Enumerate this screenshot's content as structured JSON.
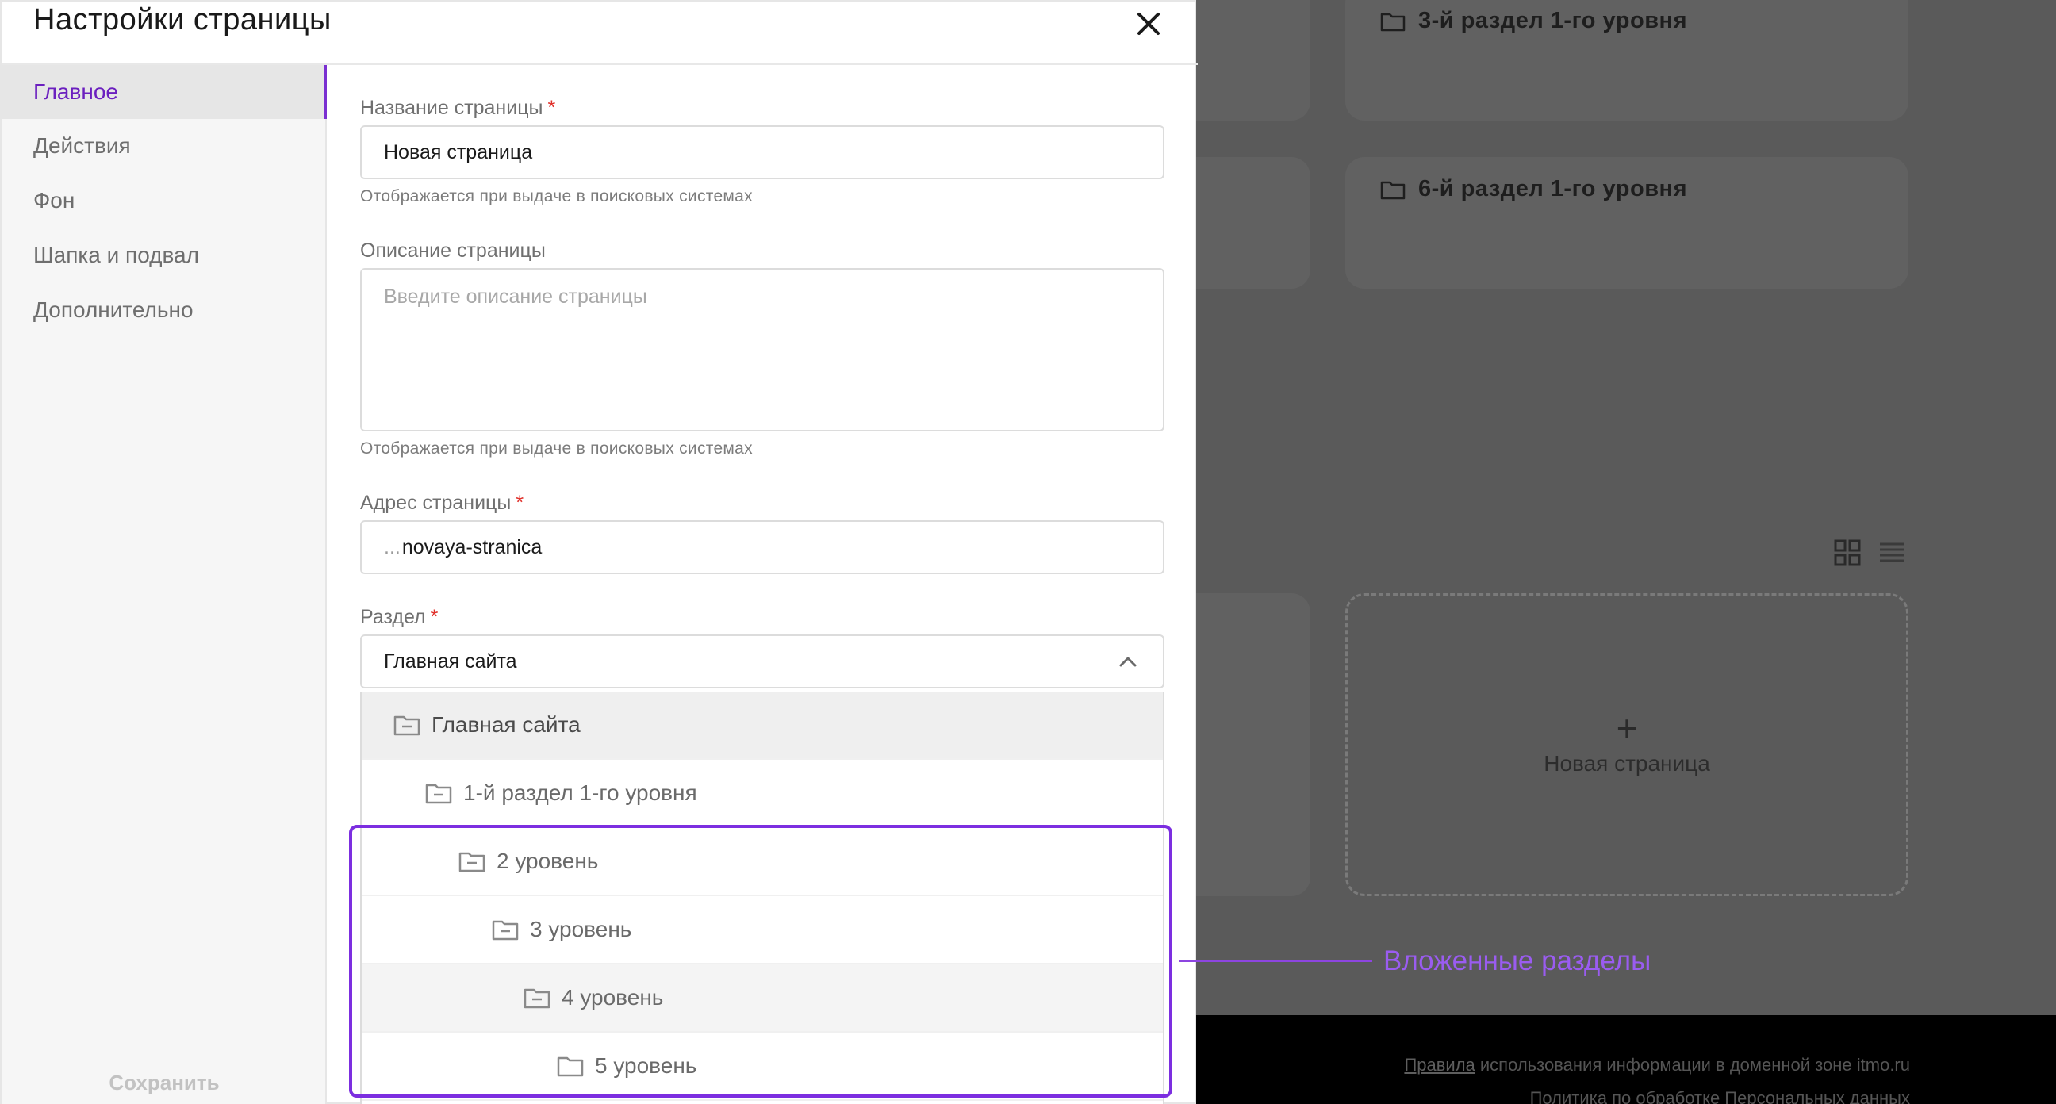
{
  "modal": {
    "title": "Настройки страницы",
    "save_label": "Сохранить"
  },
  "sidebar": {
    "items": [
      {
        "label": "Главное",
        "active": true
      },
      {
        "label": "Действия",
        "active": false
      },
      {
        "label": "Фон",
        "active": false
      },
      {
        "label": "Шапка и подвал",
        "active": false
      },
      {
        "label": "Дополнительно",
        "active": false
      }
    ]
  },
  "form": {
    "name": {
      "label": "Название страницы",
      "required_mark": "*",
      "value": "Новая страница",
      "hint": "Отображается при выдаче в поисковых системах"
    },
    "description": {
      "label": "Описание страницы",
      "placeholder": "Введите описание страницы",
      "hint": "Отображается при выдаче в поисковых системах"
    },
    "address": {
      "label": "Адрес страницы",
      "required_mark": "*",
      "prefix": "...",
      "value": "novaya-stranica"
    },
    "section": {
      "label": "Раздел",
      "required_mark": "*",
      "value": "Главная сайта"
    }
  },
  "dropdown": {
    "options": [
      {
        "label": "Главная сайта",
        "level": 0,
        "state": "selected"
      },
      {
        "label": "1-й раздел 1-го уровня",
        "level": 1,
        "state": "normal"
      },
      {
        "label": "2 уровень",
        "level": 2,
        "state": "normal"
      },
      {
        "label": "3 уровень",
        "level": 3,
        "state": "normal"
      },
      {
        "label": "4 уровень",
        "level": 4,
        "state": "hover"
      },
      {
        "label": "5 уровень",
        "level": 5,
        "state": "normal"
      }
    ]
  },
  "annotation": {
    "label": "Вложенные разделы",
    "color": "#7c2ee0"
  },
  "background_page": {
    "cards": [
      {
        "title": "3-й раздел 1-го уровня",
        "icon": "folder-icon"
      },
      {
        "title": "6-й раздел 1-го уровня",
        "icon": "folder-icon"
      }
    ],
    "new_page_card": {
      "plus": "+",
      "label": "Новая страница"
    },
    "view_icons": [
      "grid-view-icon",
      "list-view-icon"
    ],
    "footer": {
      "link_text": "Правила",
      "line1_rest": " использования информации в доменной зоне itmo.ru",
      "line2": "Политика по обработке Персональных данных"
    }
  },
  "colors": {
    "accent": "#6b1fbf",
    "required": "#e0312b",
    "overlay": "#5a5a5a"
  }
}
